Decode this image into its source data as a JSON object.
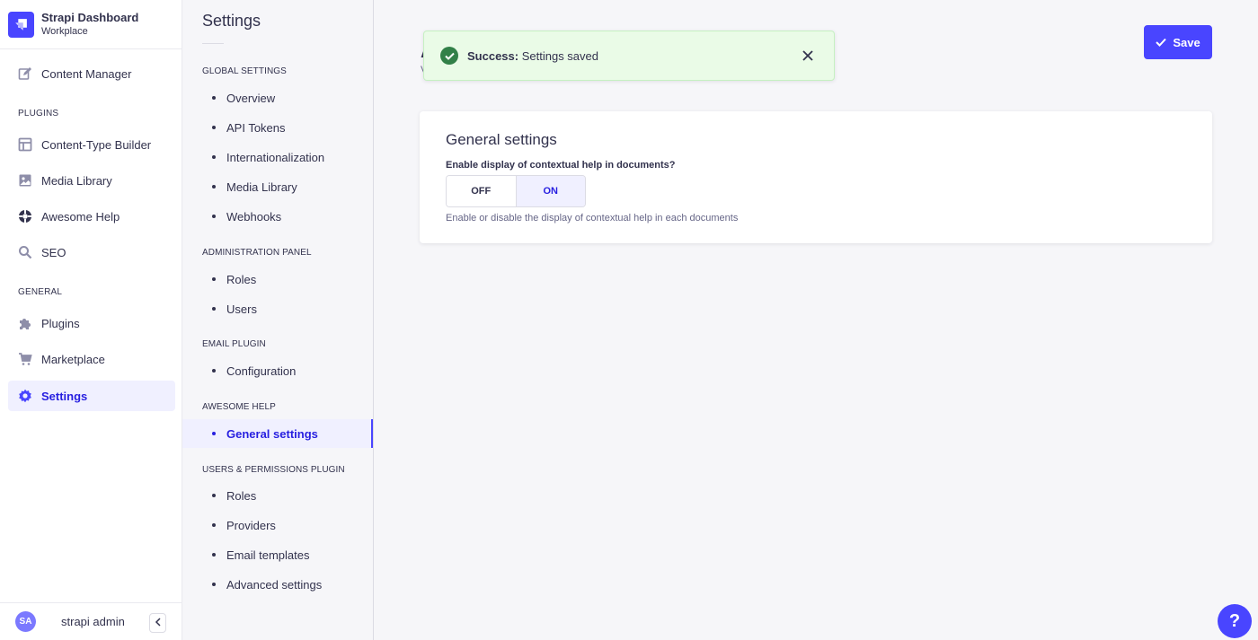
{
  "brand": {
    "title": "Strapi Dashboard",
    "subtitle": "Workplace",
    "logo_icon": "strapi-logo-icon"
  },
  "mainnav": {
    "content_manager": "Content Manager",
    "plugins_label": "PLUGINS",
    "plugins": [
      "Content-Type Builder",
      "Media Library",
      "Awesome Help",
      "SEO"
    ],
    "general_label": "GENERAL",
    "general": [
      "Plugins",
      "Marketplace",
      "Settings"
    ],
    "active": "Settings"
  },
  "footer": {
    "avatar_initials": "SA",
    "username": "strapi admin"
  },
  "subnav": {
    "title": "Settings",
    "global_label": "GLOBAL SETTINGS",
    "global": [
      "Overview",
      "API Tokens",
      "Internationalization",
      "Media Library",
      "Webhooks"
    ],
    "admin_label": "ADMINISTRATION PANEL",
    "admin": [
      "Roles",
      "Users"
    ],
    "email_label": "EMAIL PLUGIN",
    "email": [
      "Configuration"
    ],
    "awesome_label": "AWESOME HELP",
    "awesome": [
      "General settings"
    ],
    "users_label": "USERS & PERMISSIONS PLUGIN",
    "users": [
      "Roles",
      "Providers",
      "Email templates",
      "Advanced settings"
    ]
  },
  "main": {
    "hidden_title": "A",
    "hidden_sub": "V"
  },
  "toast": {
    "strong": "Success:",
    "message": "Settings saved"
  },
  "save_button": "Save",
  "card": {
    "title": "General settings",
    "field_label": "Enable display of contextual help in documents?",
    "off_label": "OFF",
    "on_label": "ON",
    "selected": "ON",
    "hint": "Enable or disable the display of contextual help in each documents"
  },
  "help_button": "?",
  "colors": {
    "primary": "#4945ff",
    "active_text": "#271fe0",
    "active_bg": "#f0f0ff",
    "success": "#328048",
    "success_bg": "#eafbe7"
  }
}
